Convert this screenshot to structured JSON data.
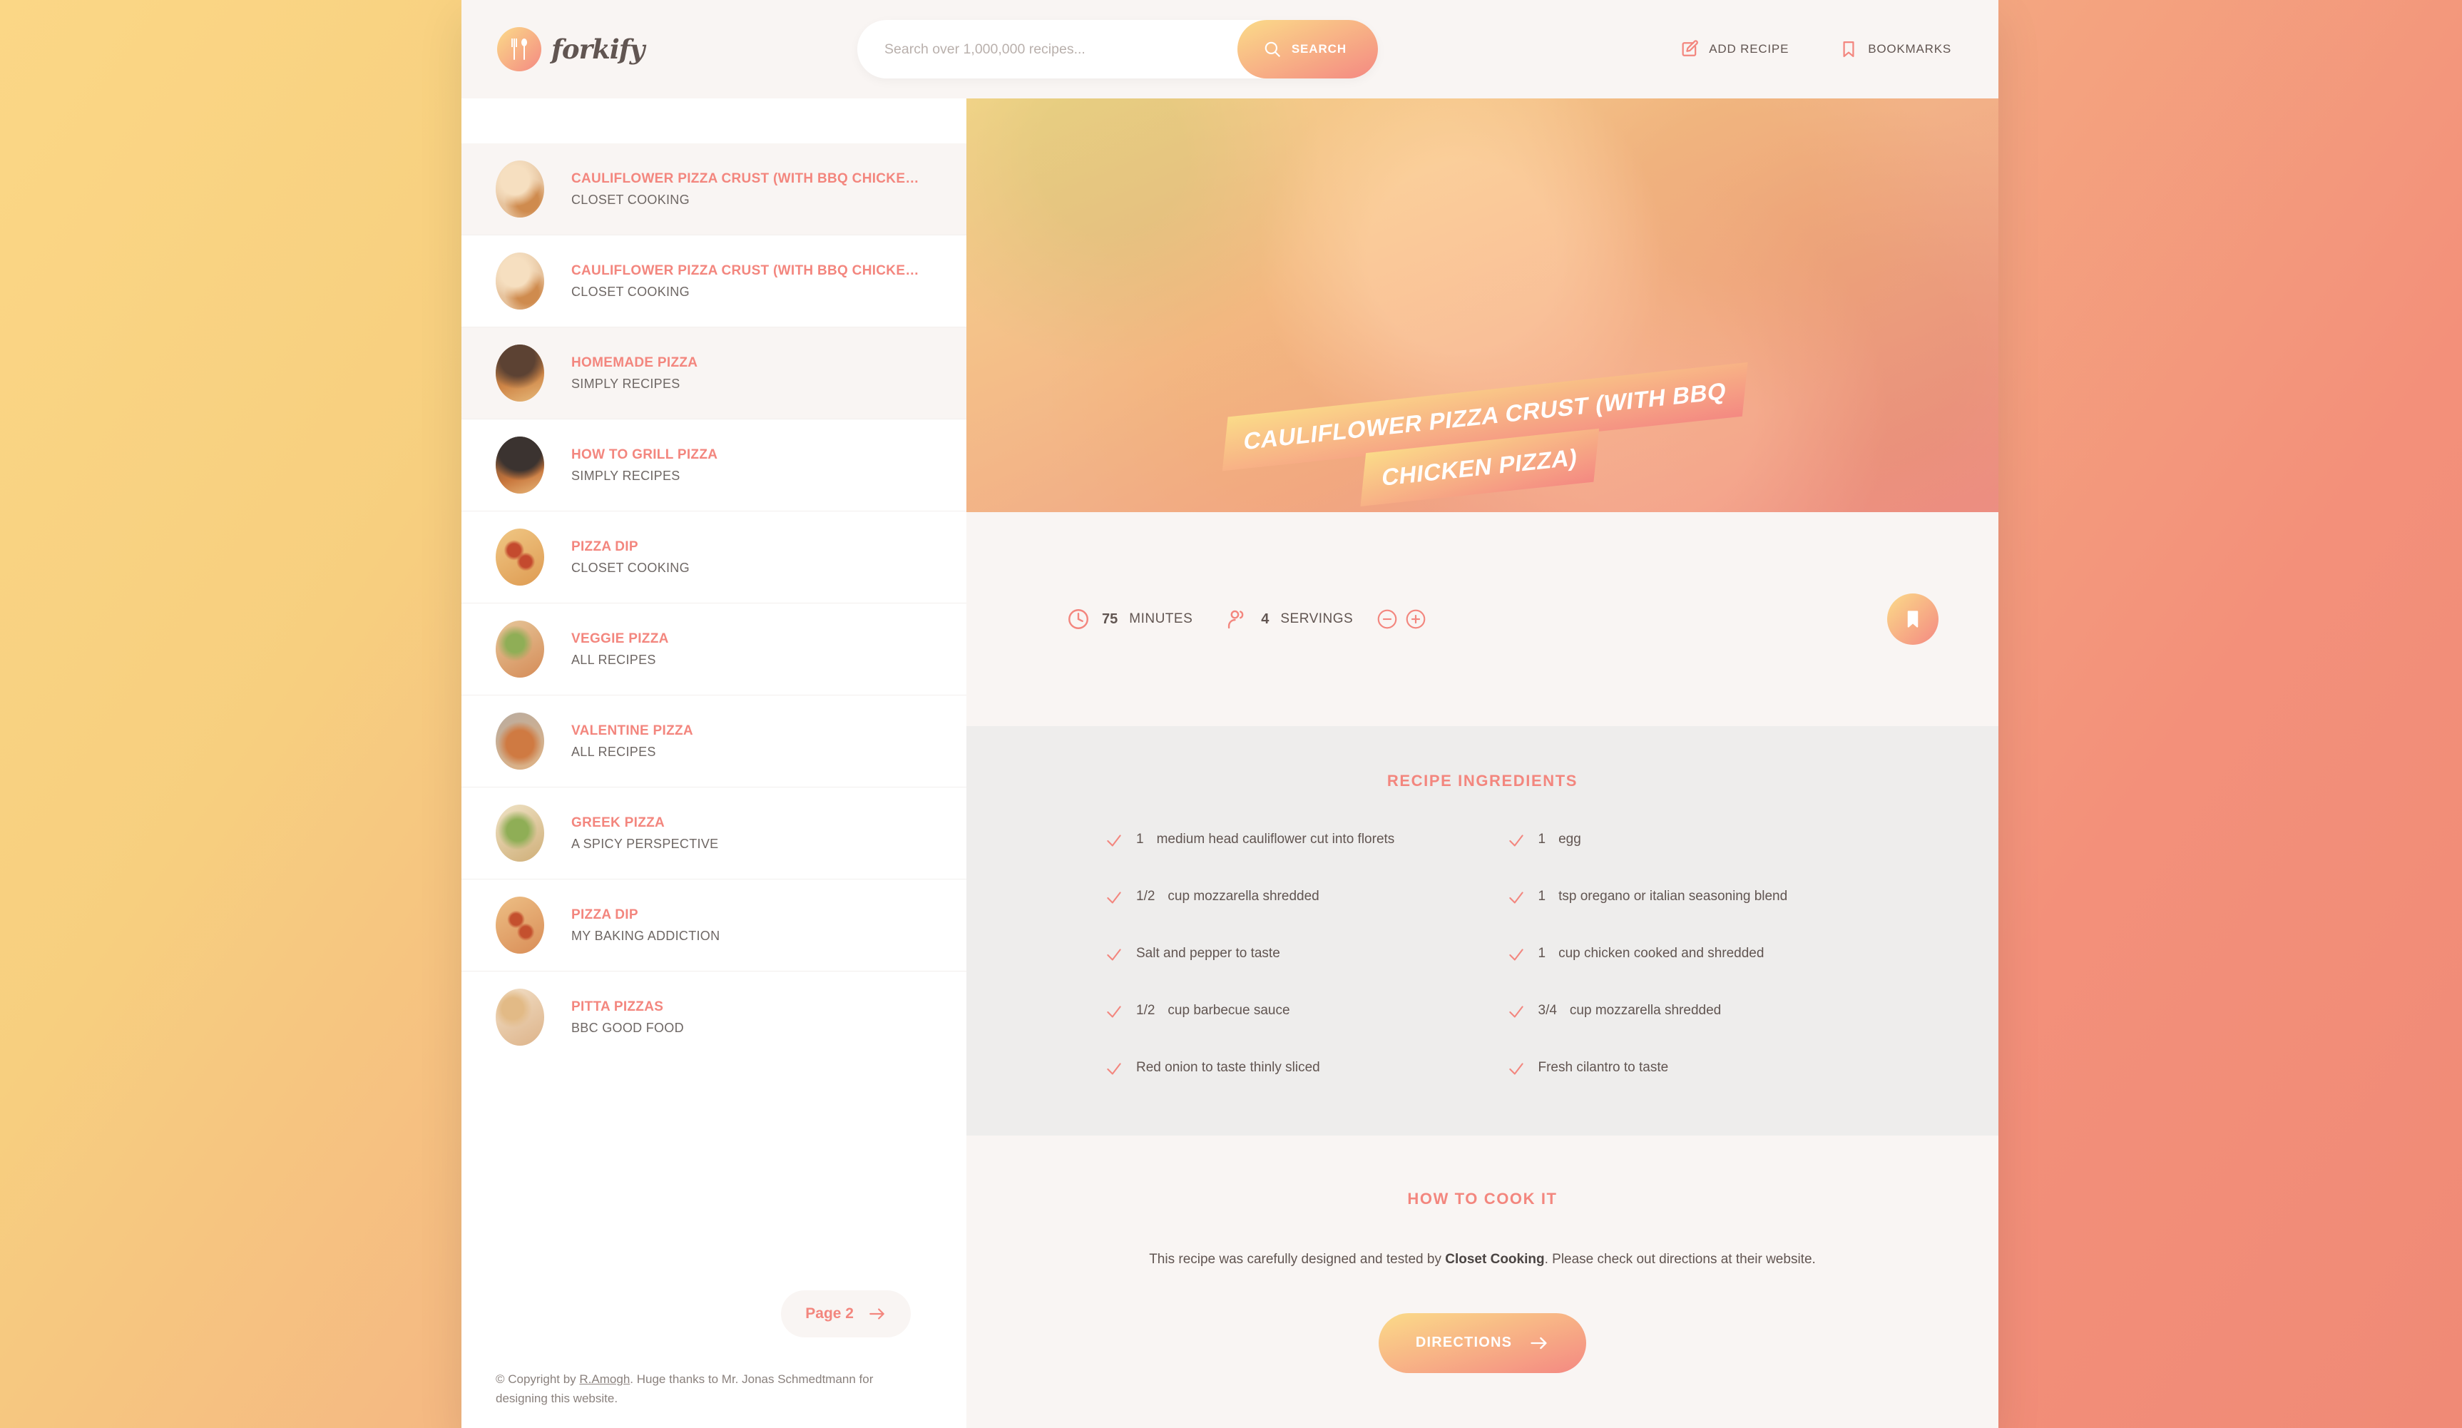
{
  "brand": {
    "name": "forkify",
    "logo_icon": "fork-spoon-icon"
  },
  "search": {
    "placeholder": "Search over 1,000,000 recipes...",
    "value": "",
    "button_label": "SEARCH",
    "icon": "search-icon"
  },
  "nav": {
    "add_recipe_label": "ADD RECIPE",
    "add_recipe_icon": "edit-square-icon",
    "bookmarks_label": "BOOKMARKS",
    "bookmarks_icon": "bookmark-icon"
  },
  "results": [
    {
      "title": "CAULIFLOWER PIZZA CRUST (WITH BBQ CHICKEN...",
      "publisher": "CLOSET COOKING",
      "active": true
    },
    {
      "title": "CAULIFLOWER PIZZA CRUST (WITH BBQ CHICKEN...",
      "publisher": "CLOSET COOKING",
      "active": false
    },
    {
      "title": "HOMEMADE PIZZA",
      "publisher": "SIMPLY RECIPES",
      "active": true
    },
    {
      "title": "HOW TO GRILL PIZZA",
      "publisher": "SIMPLY RECIPES",
      "active": false
    },
    {
      "title": "PIZZA DIP",
      "publisher": "CLOSET COOKING",
      "active": false
    },
    {
      "title": "VEGGIE PIZZA",
      "publisher": "ALL RECIPES",
      "active": false
    },
    {
      "title": "VALENTINE PIZZA",
      "publisher": "ALL RECIPES",
      "active": false
    },
    {
      "title": "GREEK PIZZA",
      "publisher": "A SPICY PERSPECTIVE",
      "active": false
    },
    {
      "title": "PIZZA DIP",
      "publisher": "MY BAKING ADDICTION",
      "active": false
    },
    {
      "title": "PITTA PIZZAS",
      "publisher": "BBC GOOD FOOD",
      "active": false
    }
  ],
  "pagination": {
    "next_label": "Page 2",
    "arrow_icon": "arrow-right-icon"
  },
  "footer": {
    "copyright_prefix": "© Copyright by ",
    "author": "R.Amogh",
    "copyright_suffix": ". Huge thanks to Mr. Jonas Schmedtmann for designing this website."
  },
  "recipe": {
    "title_line1": "CAULIFLOWER PIZZA CRUST (WITH BBQ",
    "title_line2": "CHICKEN PIZZA)",
    "cook_time": "75",
    "cook_time_label": "MINUTES",
    "servings": "4",
    "servings_label": "SERVINGS",
    "clock_icon": "clock-icon",
    "users_icon": "users-icon",
    "decrease_icon": "minus-circle-icon",
    "increase_icon": "plus-circle-icon",
    "bookmark_icon": "bookmark-icon",
    "ingredients_heading": "RECIPE INGREDIENTS",
    "ingredients": [
      {
        "quantity": "1",
        "description": "medium head cauliflower cut into florets"
      },
      {
        "quantity": "1",
        "description": "egg"
      },
      {
        "quantity": "1/2",
        "description": "cup mozzarella shredded"
      },
      {
        "quantity": "1",
        "description": "tsp oregano or italian seasoning blend"
      },
      {
        "quantity": "",
        "description": "Salt and pepper to taste"
      },
      {
        "quantity": "1",
        "description": "cup chicken cooked and shredded"
      },
      {
        "quantity": "1/2",
        "description": "cup barbecue sauce"
      },
      {
        "quantity": "3/4",
        "description": "cup mozzarella shredded"
      },
      {
        "quantity": "",
        "description": "Red onion to taste thinly sliced"
      },
      {
        "quantity": "",
        "description": "Fresh cilantro to taste"
      }
    ],
    "how_to_cook_heading": "HOW TO COOK IT",
    "directions_text_prefix": "This recipe was carefully designed and tested by ",
    "directions_publisher": "Closet Cooking",
    "directions_text_suffix": ". Please check out directions at their website.",
    "directions_button_label": "DIRECTIONS",
    "directions_arrow_icon": "arrow-right-icon"
  },
  "colors": {
    "accent": "#f3867e",
    "gradient_start": "#fbdb89",
    "gradient_end": "#f48982",
    "text_dark": "#615551",
    "bg_light": "#f9f5f3",
    "bg_grey": "#eeedec"
  }
}
